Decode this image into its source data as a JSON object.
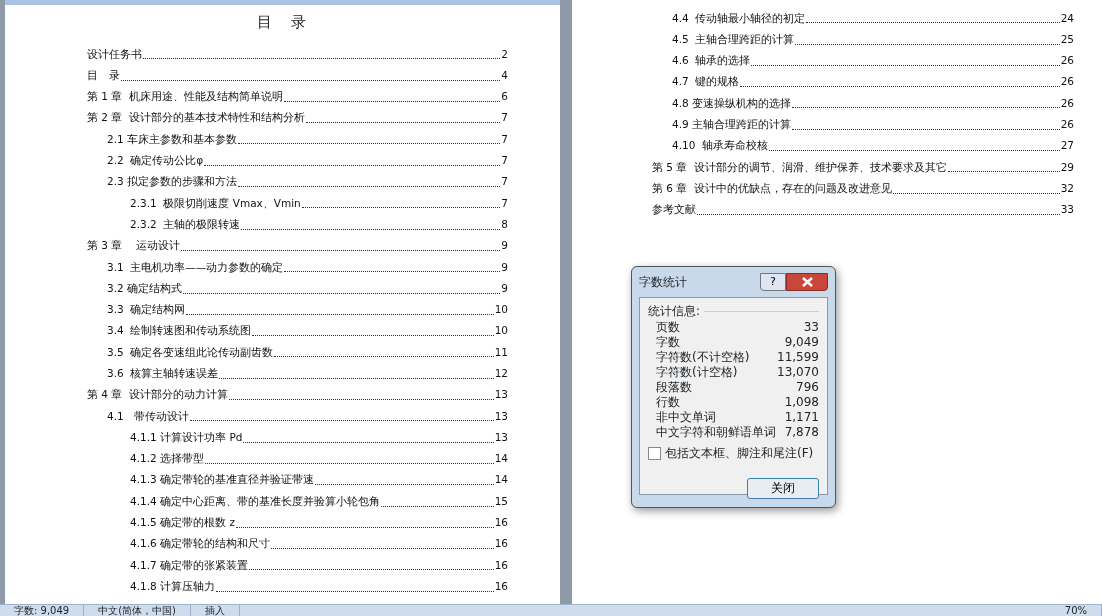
{
  "left_page": {
    "title": "目　录",
    "entries": [
      {
        "title": "设计任务书",
        "page": "2"
      },
      {
        "title": "目　录",
        "page": "4"
      },
      {
        "title": "第 1 章  机床用途、性能及结构简单说明",
        "page": "6"
      },
      {
        "title": "第 2 章  设计部分的基本技术特性和结构分析",
        "page": "7",
        "children": [
          {
            "title": "2.1 车床主参数和基本参数",
            "page": "7"
          },
          {
            "title": "2.2  确定传动公比φ",
            "page": "7"
          },
          {
            "title": "2.3 拟定参数的步骤和方法",
            "page": "7",
            "children": [
              {
                "title": "2.3.1  极限切削速度 Vmax、Vmin",
                "page": "7"
              },
              {
                "title": "2.3.2  主轴的极限转速",
                "page": "8"
              }
            ]
          }
        ]
      },
      {
        "title": "第 3 章    运动设计",
        "page": "9",
        "children": [
          {
            "title": "3.1  主电机功率——动力参数的确定",
            "page": "9"
          },
          {
            "title": "3.2 确定结构式",
            "page": "9"
          },
          {
            "title": "3.3  确定结构网",
            "page": "10"
          },
          {
            "title": "3.4  绘制转速图和传动系统图",
            "page": "10"
          },
          {
            "title": "3.5  确定各变速组此论传动副齿数",
            "page": "11"
          },
          {
            "title": "3.6  核算主轴转速误差",
            "page": "12"
          }
        ]
      },
      {
        "title": "第 4 章  设计部分的动力计算",
        "page": "13",
        "children": [
          {
            "title": "4.1   带传动设计",
            "page": "13",
            "children": [
              {
                "title": "4.1.1 计算设计功率 Pd",
                "page": "13"
              },
              {
                "title": "4.1.2 选择带型",
                "page": "14"
              },
              {
                "title": "4.1.3 确定带轮的基准直径并验证带速",
                "page": "14"
              },
              {
                "title": "4.1.4 确定中心距离、带的基准长度并验算小轮包角",
                "page": "15"
              },
              {
                "title": "4.1.5 确定带的根数 z",
                "page": "16"
              },
              {
                "title": "4.1.6 确定带轮的结构和尺寸",
                "page": "16"
              },
              {
                "title": "4.1.7 确定带的张紧装置",
                "page": "16"
              },
              {
                "title": "4.1.8 计算压轴力",
                "page": "16"
              }
            ]
          }
        ]
      }
    ]
  },
  "right_page": {
    "continued_sections": [
      {
        "title": "4.4  传动轴最小轴径的初定",
        "page": "24"
      },
      {
        "title": "4.5  主轴合理跨距的计算",
        "page": "25"
      },
      {
        "title": "4.6  轴承的选择",
        "page": "26"
      },
      {
        "title": "4.7  键的规格",
        "page": "26"
      },
      {
        "title": "4.8 变速操纵机构的选择",
        "page": "26"
      },
      {
        "title": "4.9 主轴合理跨距的计算",
        "page": "26"
      },
      {
        "title": "4.10  轴承寿命校核",
        "page": "27"
      }
    ],
    "entries": [
      {
        "title": "第 5 章  设计部分的调节、润滑、维护保养、技术要求及其它",
        "page": "29"
      },
      {
        "title": "第 6 章  设计中的优缺点，存在的问题及改进意见",
        "page": "32"
      },
      {
        "title": "参考文献",
        "page": "33"
      }
    ]
  },
  "dialog": {
    "title": "字数统计",
    "help_button": "?",
    "group_label": "统计信息:",
    "stats": [
      {
        "label": "页数",
        "value": "33"
      },
      {
        "label": "字数",
        "value": "9,049"
      },
      {
        "label": "字符数(不计空格)",
        "value": "11,599"
      },
      {
        "label": "字符数(计空格)",
        "value": "13,070"
      },
      {
        "label": "段落数",
        "value": "796"
      },
      {
        "label": "行数",
        "value": "1,098"
      },
      {
        "label": "非中文单词",
        "value": "1,171"
      },
      {
        "label": "中文字符和朝鲜语单词",
        "value": "7,878"
      }
    ],
    "checkbox": {
      "label": "包括文本框、脚注和尾注(F)",
      "checked": false
    },
    "close_button": "关闭"
  },
  "status_bar": {
    "word_count": "字数: 9,049",
    "language": "中文(简体，中国)",
    "mode": "插入",
    "zoom": "70%"
  }
}
